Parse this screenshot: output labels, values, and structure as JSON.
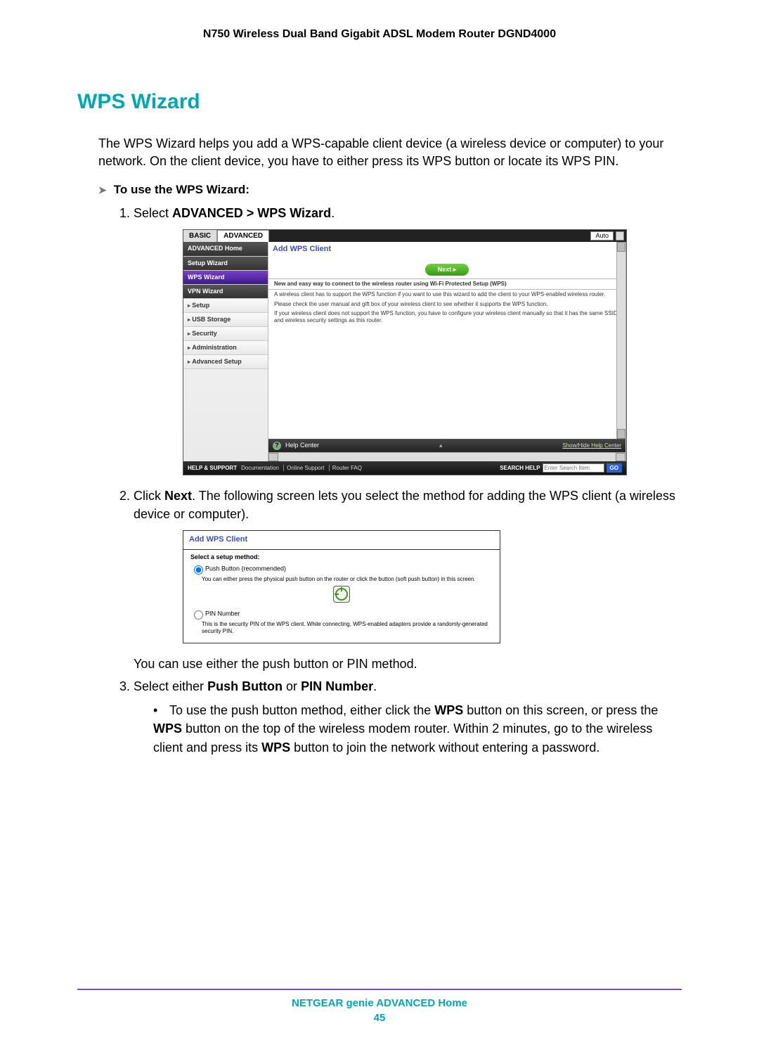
{
  "doc_header": "N750 Wireless Dual Band Gigabit ADSL Modem Router DGND4000",
  "section_title": "WPS Wizard",
  "intro_text": "The WPS Wizard helps you add a WPS-capable client device (a wireless device or computer) to your network. On the client device, you have to either press its WPS button or locate its WPS PIN.",
  "procedure_title": "To use the WPS Wizard:",
  "step1_prefix": "Select ",
  "step1_bold": "ADVANCED > WPS Wizard",
  "step1_suffix": ".",
  "ui1": {
    "tab_basic": "BASIC",
    "tab_advanced": "ADVANCED",
    "auto": "Auto",
    "nav": {
      "home": "ADVANCED Home",
      "setup_wizard": "Setup Wizard",
      "wps_wizard": "WPS Wizard",
      "vpn_wizard": "VPN Wizard",
      "setup": "Setup",
      "usb_storage": "USB Storage",
      "security": "Security",
      "administration": "Administration",
      "advanced_setup": "Advanced Setup"
    },
    "panel_title": "Add WPS Client",
    "next_label": "Next    ▸",
    "info1": "New and easy way to connect to the wireless router using Wi-Fi Protected Setup (WPS)",
    "info2": "A wireless client has to support the WPS function if you want to use this wizard to add the client to your WPS-enabled wireless router.",
    "info3": "Please check the user manual and gift box of your wireless client to see whether it supports the WPS function.",
    "info4": "If your wireless client does not support the WPS function, you have to configure your wireless client manually so that it has the same SSID and wireless security settings as this router.",
    "help_center": "Help Center",
    "help_link": "Show/Hide Help Center",
    "footer_label": "HELP & SUPPORT",
    "footer_links": {
      "a": "Documentation",
      "b": "Online Support",
      "c": "Router FAQ"
    },
    "search_label": "SEARCH HELP",
    "search_placeholder": "Enter Search Item",
    "go": "GO"
  },
  "step2_a": "Click ",
  "step2_b": "Next",
  "step2_c": ". The following screen lets you select the method for adding the WPS client (a wireless device or computer).",
  "ui2": {
    "panel_title": "Add WPS Client",
    "method_head": "Select a setup method:",
    "opt_pb": "Push Button (recommended)",
    "desc_pb": "You can either press the physical push button on the router or click the button (soft push button) in this screen.",
    "opt_pin": "PIN Number",
    "desc_pin": "This is the security PIN of the WPS client. While connecting, WPS-enabled adapters provide a randomly-generated security PIN."
  },
  "step2_note": "You can use either the push button or PIN method.",
  "step3_a": "Select either ",
  "step3_b": "Push Button",
  "step3_c": " or ",
  "step3_d": "PIN Number",
  "step3_e": ".",
  "bullet1_a": "To use the push button method, either click the ",
  "bullet1_b": "WPS",
  "bullet1_c": " button on this screen, or press the ",
  "bullet1_d": "WPS",
  "bullet1_e": " button on the top of the wireless modem router. Within 2 minutes, go to the wireless client and press its ",
  "bullet1_f": "WPS",
  "bullet1_g": " button to join the network without entering a password.",
  "footer_title": "NETGEAR genie ADVANCED Home",
  "page_number": "45"
}
